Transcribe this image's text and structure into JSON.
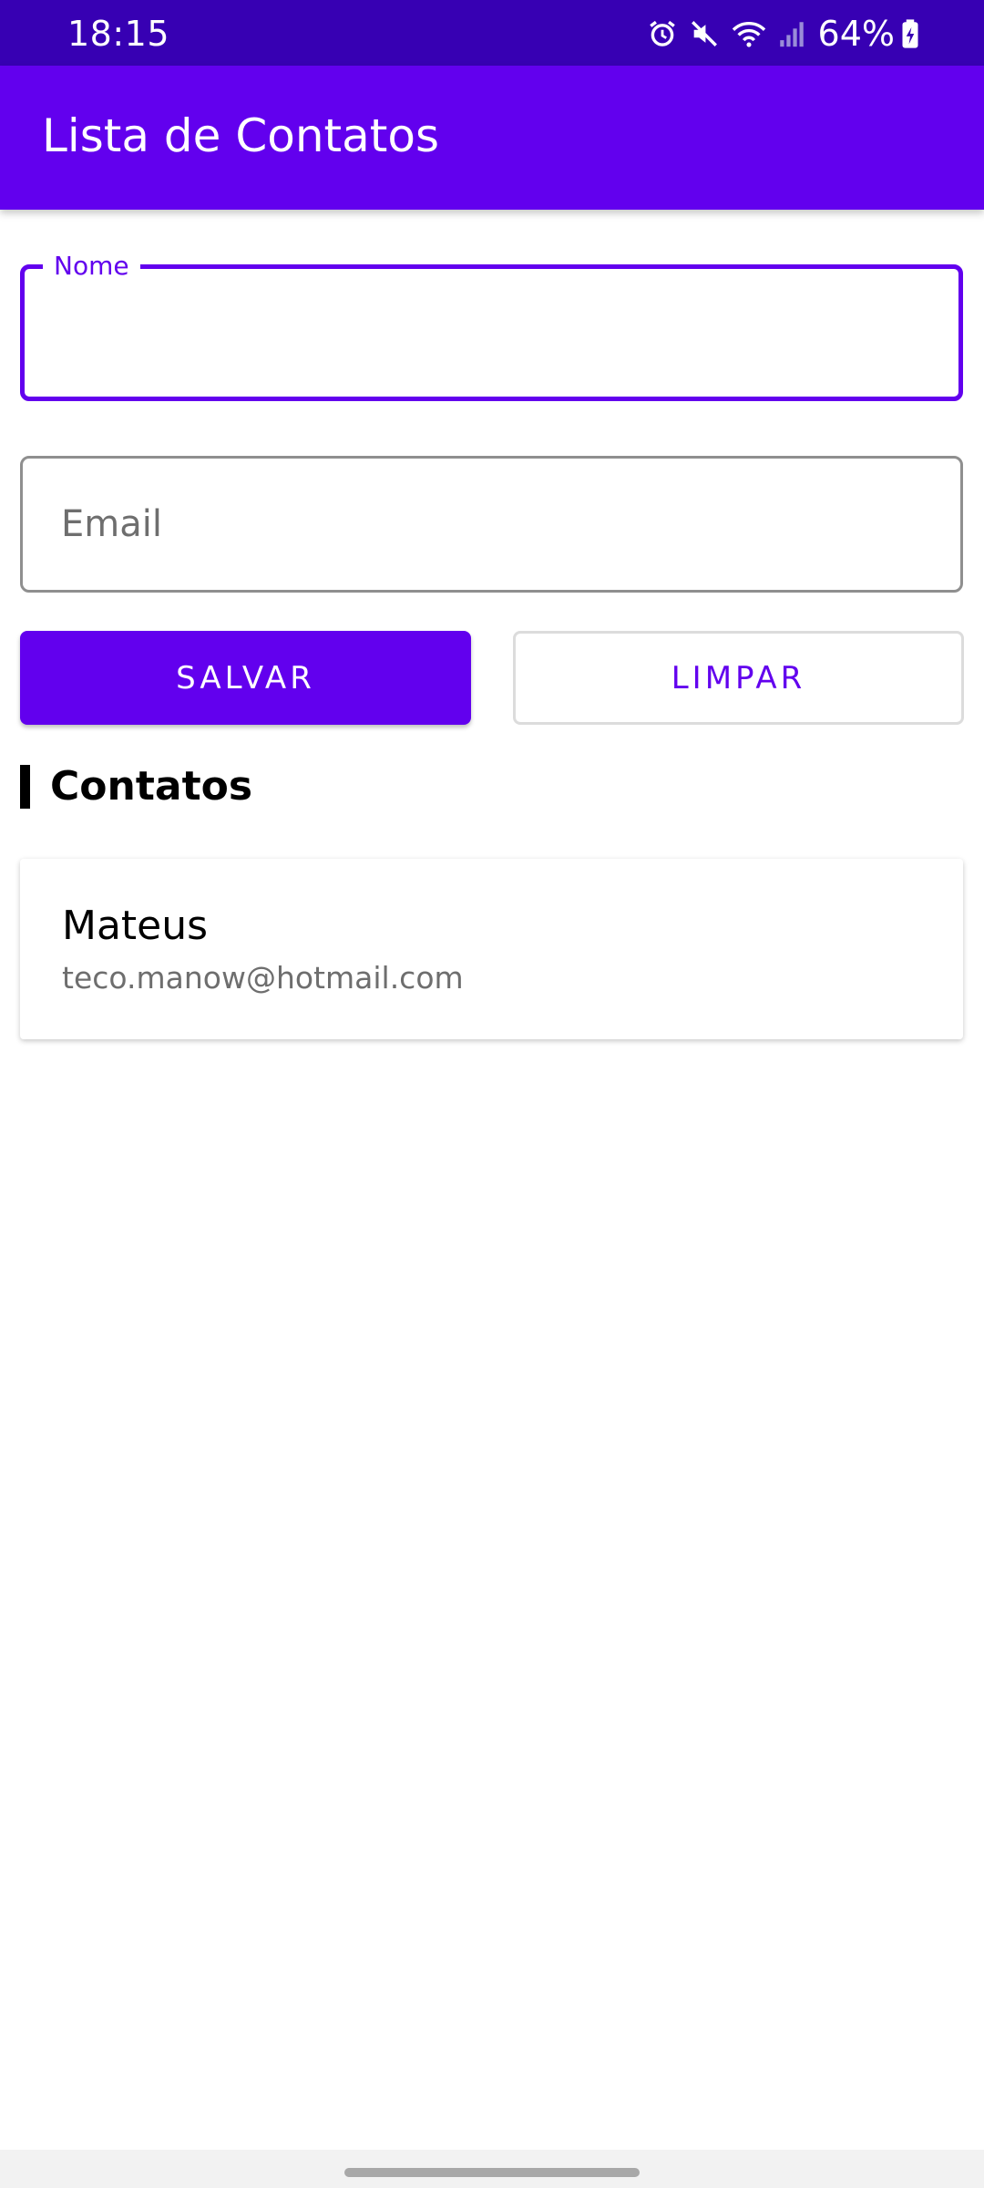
{
  "status_bar": {
    "time": "18:15",
    "battery": "64%",
    "icons": [
      "alarm-icon",
      "mute-icon",
      "wifi-icon",
      "signal-icon",
      "battery-charging-icon"
    ]
  },
  "app_bar": {
    "title": "Lista de Contatos",
    "color": "#6200ee"
  },
  "form": {
    "name_label": "Nome",
    "name_value": "",
    "email_placeholder": "Email",
    "email_value": "",
    "save_label": "SALVAR",
    "clear_label": "LIMPAR"
  },
  "contacts_section": {
    "title": "Contatos",
    "items": [
      {
        "name": "Mateus",
        "email": "teco.manow@hotmail.com"
      }
    ]
  },
  "colors": {
    "primary": "#6200ee",
    "primary_dark": "#3700b3",
    "secondary_text": "#6e6e6e"
  }
}
